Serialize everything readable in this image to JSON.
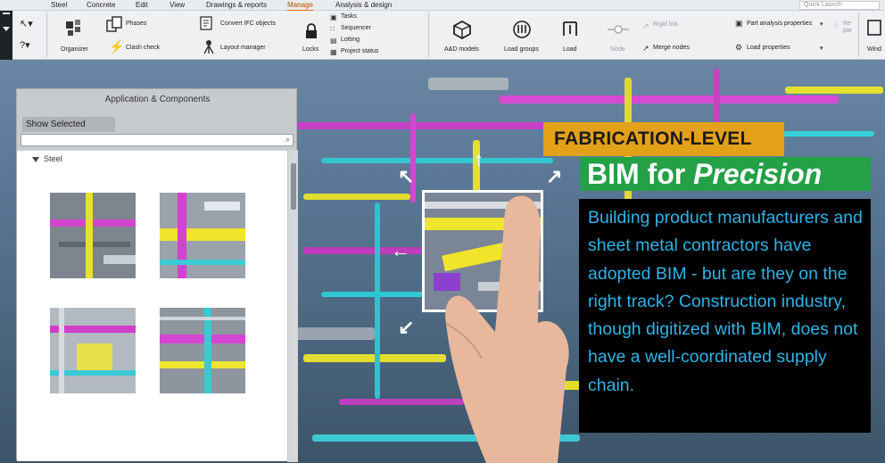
{
  "menu": {
    "items": [
      "Steel",
      "Concrete",
      "Edit",
      "View",
      "Drawings & reports",
      "Manage",
      "Analysis & design"
    ],
    "active": "Manage",
    "quick_launch_placeholder": "Quick Launch"
  },
  "ribbon": {
    "organizer": "Organizer",
    "phases": "Phases",
    "clash_check": "Clash check",
    "convert_ifc": "Convert IFC objects",
    "layout_manager": "Layout manager",
    "locks": "Locks",
    "tasks": "Tasks",
    "sequencer": "Sequencer",
    "lotting": "Lotting",
    "project_status": "Project status",
    "ad_models": "A&D models",
    "load_groups": "Load groups",
    "load": "Load",
    "node": "Node",
    "rigid_link": "Rigid link",
    "merge_nodes": "Merge nodes",
    "part_analysis_properties": "Part analysis properties",
    "load_properties": "Load properties",
    "re_par": "Re par",
    "wind": "Wind"
  },
  "panel": {
    "title": "Application & Components",
    "show_selected": "Show Selected",
    "tree_root": "Steel"
  },
  "headline": {
    "line1": "FABRICATION-LEVEL",
    "line2_plain": "BIM for ",
    "line2_italic": "Precision"
  },
  "body_text": "Building product manufacturers and sheet metal contractors have adopted BIM - but are they on the right track? Construction industry, though digitized with BIM, does not have a well-coordinated supply chain.",
  "colors": {
    "accent_orange": "#e3a11a",
    "accent_green": "#24a047",
    "text_blue": "#2fb4e8",
    "menu_active": "#e36b00"
  }
}
